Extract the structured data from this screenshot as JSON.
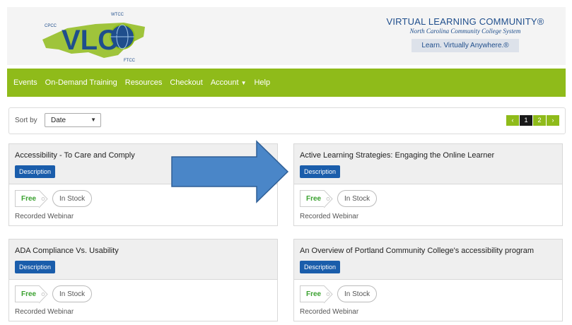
{
  "logo": {
    "letters": "VLC",
    "small_labels": [
      "WTCC",
      "CPCC",
      "FTCC"
    ]
  },
  "brand": {
    "title": "VIRTUAL LEARNING COMMUNITY®",
    "subtitle": "North Carolina Community College System",
    "tagline": "Learn. Virtually Anywhere.®"
  },
  "nav": {
    "items": [
      "Events",
      "On-Demand Training",
      "Resources",
      "Checkout",
      "Account",
      "Help"
    ],
    "account_caret": "▼"
  },
  "sort": {
    "label": "Sort by",
    "value": "Date",
    "arrow": "▼"
  },
  "pager": {
    "prev": "‹",
    "pages": [
      "1",
      "2"
    ],
    "next": "›",
    "current": "1"
  },
  "products": [
    {
      "title": "Accessibility - To Care and Comply",
      "button": "Description",
      "price": "Free",
      "stock": "In Stock",
      "type": "Recorded Webinar"
    },
    {
      "title": "Active Learning Strategies: Engaging the Online Learner",
      "button": "Description",
      "price": "Free",
      "stock": "In Stock",
      "type": "Recorded Webinar"
    },
    {
      "title": "ADA Compliance Vs. Usability",
      "button": "Description",
      "price": "Free",
      "stock": "In Stock",
      "type": "Recorded Webinar"
    },
    {
      "title": "An Overview of Portland Community College's accessibility program",
      "button": "Description",
      "price": "Free",
      "stock": "In Stock",
      "type": "Recorded Webinar"
    }
  ],
  "colors": {
    "nav": "#8fbb1a",
    "brand": "#1f4e8c",
    "button": "#1a5dab",
    "arrow": "#4a86c8",
    "free": "#3aa12f"
  }
}
